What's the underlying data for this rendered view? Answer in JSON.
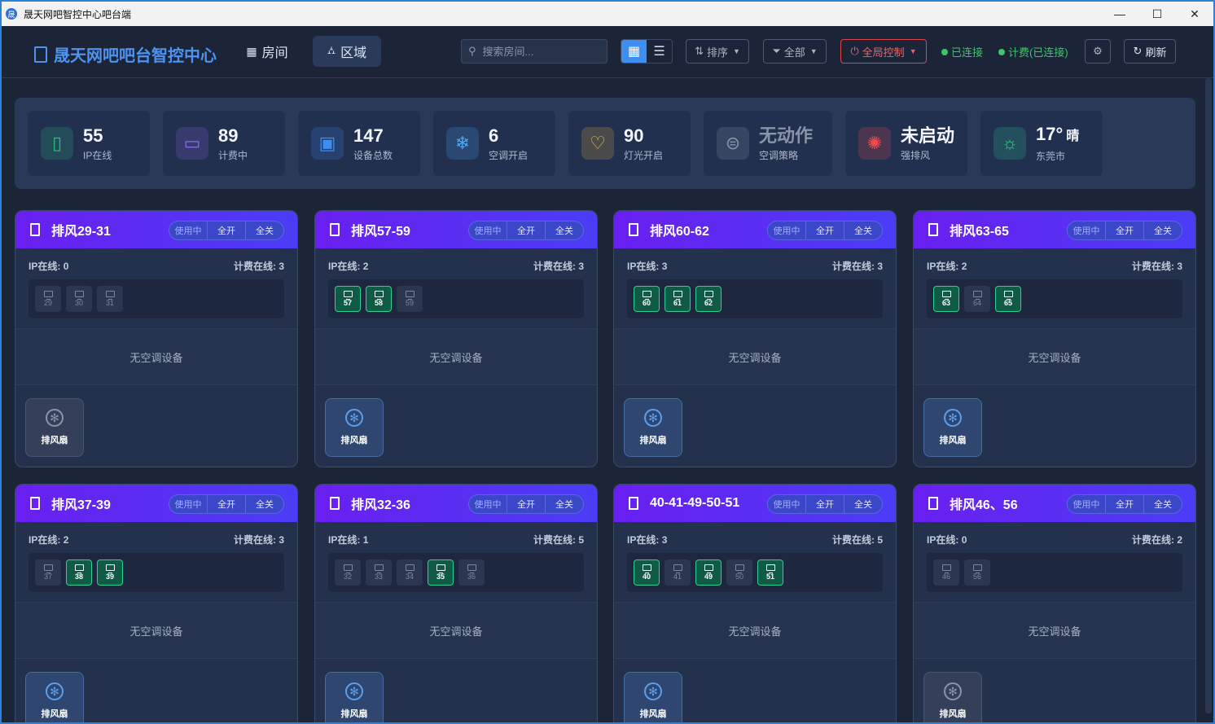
{
  "window": {
    "title": "晟天网吧智控中心吧台端",
    "app_icon": "晟"
  },
  "header": {
    "brand": "晟天网吧吧台智控中心",
    "nav": [
      {
        "label": "房间"
      },
      {
        "label": "区域"
      }
    ],
    "search_placeholder": "搜索房间...",
    "sort_label": "排序",
    "filter_label": "全部",
    "global_control_label": "全局控制",
    "status_connected": "已连接",
    "status_billing": "计费(已连接)",
    "refresh_label": "刷新"
  },
  "stats": [
    {
      "value": "55",
      "label": "IP在线",
      "icon": "device-icon",
      "color": "#27c07a"
    },
    {
      "value": "89",
      "label": "计费中",
      "icon": "card-icon",
      "color": "#8a6be8"
    },
    {
      "value": "147",
      "label": "设备总数",
      "icon": "chip-icon",
      "color": "#3d8ef0"
    },
    {
      "value": "6",
      "label": "空调开启",
      "icon": "snowflake-icon",
      "color": "#4aa8f5"
    },
    {
      "value": "90",
      "label": "灯光开启",
      "icon": "bulb-icon",
      "color": "#f0b93a"
    },
    {
      "value": "无动作",
      "label": "空调策略",
      "icon": "toggle-icon",
      "color": "#8a94a8"
    },
    {
      "value": "未启动",
      "label": "强排风",
      "icon": "fan-icon",
      "color": "#f04a4a"
    },
    {
      "value": "17°",
      "unit": "晴",
      "label": "东莞市",
      "icon": "sun-icon",
      "color": "#2ed191"
    }
  ],
  "card_labels": {
    "status": "使用中",
    "all_on": "全开",
    "all_off": "全关",
    "ip_online": "IP在线:",
    "billing_online": "计费在线:",
    "no_ac": "无空调设备",
    "fan": "排风扇"
  },
  "cards": [
    {
      "name": "排风29-31",
      "ip": "0",
      "billing": "3",
      "fan_on": false,
      "devices": [
        {
          "n": "29",
          "on": false
        },
        {
          "n": "30",
          "on": false
        },
        {
          "n": "31",
          "on": false
        }
      ]
    },
    {
      "name": "排风57-59",
      "ip": "2",
      "billing": "3",
      "fan_on": true,
      "devices": [
        {
          "n": "57",
          "on": true
        },
        {
          "n": "58",
          "on": true
        },
        {
          "n": "59",
          "on": false
        }
      ]
    },
    {
      "name": "排风60-62",
      "ip": "3",
      "billing": "3",
      "fan_on": true,
      "devices": [
        {
          "n": "60",
          "on": true
        },
        {
          "n": "61",
          "on": true
        },
        {
          "n": "62",
          "on": true
        }
      ]
    },
    {
      "name": "排风63-65",
      "ip": "2",
      "billing": "3",
      "fan_on": true,
      "devices": [
        {
          "n": "63",
          "on": true
        },
        {
          "n": "64",
          "on": false
        },
        {
          "n": "65",
          "on": true
        }
      ]
    },
    {
      "name": "排风37-39",
      "ip": "2",
      "billing": "3",
      "fan_on": true,
      "devices": [
        {
          "n": "37",
          "on": false
        },
        {
          "n": "38",
          "on": true
        },
        {
          "n": "39",
          "on": true
        }
      ]
    },
    {
      "name": "排风32-36",
      "ip": "1",
      "billing": "5",
      "fan_on": true,
      "devices": [
        {
          "n": "32",
          "on": false
        },
        {
          "n": "33",
          "on": false
        },
        {
          "n": "34",
          "on": false
        },
        {
          "n": "35",
          "on": true
        },
        {
          "n": "36",
          "on": false
        }
      ]
    },
    {
      "name": "40-41-49-50-51",
      "ip": "3",
      "billing": "5",
      "fan_on": true,
      "devices": [
        {
          "n": "40",
          "on": true
        },
        {
          "n": "41",
          "on": false
        },
        {
          "n": "49",
          "on": true
        },
        {
          "n": "50",
          "on": false
        },
        {
          "n": "51",
          "on": true
        }
      ]
    },
    {
      "name": "排风46、56",
      "ip": "0",
      "billing": "2",
      "fan_on": false,
      "devices": [
        {
          "n": "46",
          "on": false
        },
        {
          "n": "56",
          "on": false
        }
      ]
    }
  ]
}
